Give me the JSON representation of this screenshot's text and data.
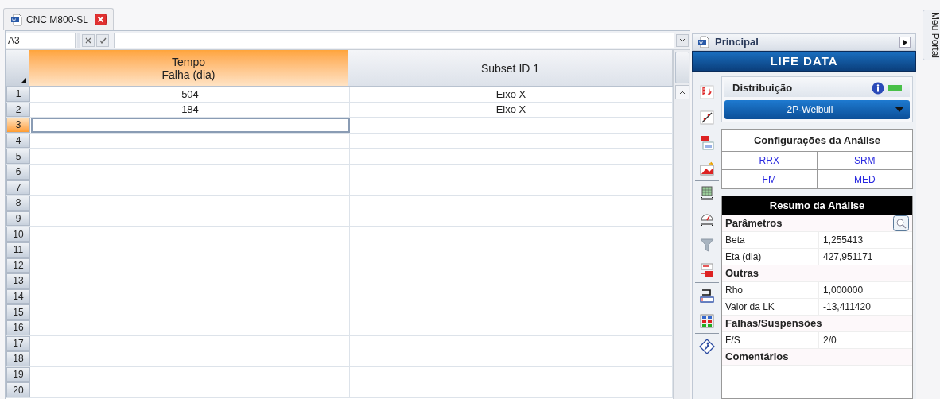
{
  "tab": {
    "title": "CNC M800-SL"
  },
  "formula_bar": {
    "cell_ref": "A3"
  },
  "grid": {
    "columns": [
      {
        "label": "Tempo\nFalha (dia)",
        "selected": true
      },
      {
        "label": "Subset ID 1",
        "selected": false
      }
    ],
    "rows": [
      {
        "number": "1",
        "selected": false,
        "cells": [
          "504",
          "Eixo X"
        ]
      },
      {
        "number": "2",
        "selected": false,
        "cells": [
          "184",
          "Eixo X"
        ]
      },
      {
        "number": "3",
        "selected": true
      },
      {
        "number": "4",
        "selected": false
      },
      {
        "number": "5",
        "selected": false
      },
      {
        "number": "6",
        "selected": false
      },
      {
        "number": "7",
        "selected": false
      },
      {
        "number": "8",
        "selected": false
      },
      {
        "number": "9",
        "selected": false
      },
      {
        "number": "10",
        "selected": false
      },
      {
        "number": "11",
        "selected": false
      },
      {
        "number": "12",
        "selected": false
      },
      {
        "number": "13",
        "selected": false
      },
      {
        "number": "14",
        "selected": false
      },
      {
        "number": "15",
        "selected": false
      },
      {
        "number": "16",
        "selected": false
      },
      {
        "number": "17",
        "selected": false
      },
      {
        "number": "18",
        "selected": false
      },
      {
        "number": "19",
        "selected": false
      },
      {
        "number": "20",
        "selected": false
      }
    ]
  },
  "panel": {
    "title": "Principal",
    "banner": "LIFE DATA",
    "distribution": {
      "title": "Distribuição",
      "value": "2P-Weibull"
    },
    "settings": {
      "title": "Configurações da Análise",
      "items": [
        "RRX",
        "SRM",
        "FM",
        "MED"
      ]
    },
    "summary": {
      "title": "Resumo da Análise",
      "sections": [
        {
          "title": "Parâmetros",
          "rows": [
            {
              "label": "Beta",
              "value": "1,255413"
            },
            {
              "label": "Eta (dia)",
              "value": "427,951171"
            }
          ]
        },
        {
          "title": "Outras",
          "rows": [
            {
              "label": "Rho",
              "value": "1,000000"
            },
            {
              "label": "Valor da LK",
              "value": "-13,411420"
            }
          ]
        },
        {
          "title": "Falhas/Suspensões",
          "rows": [
            {
              "label": "F/S",
              "value": "2/0"
            }
          ]
        },
        {
          "title": "Comentários"
        }
      ]
    }
  },
  "side_tab": {
    "label": "Meu Portal"
  }
}
